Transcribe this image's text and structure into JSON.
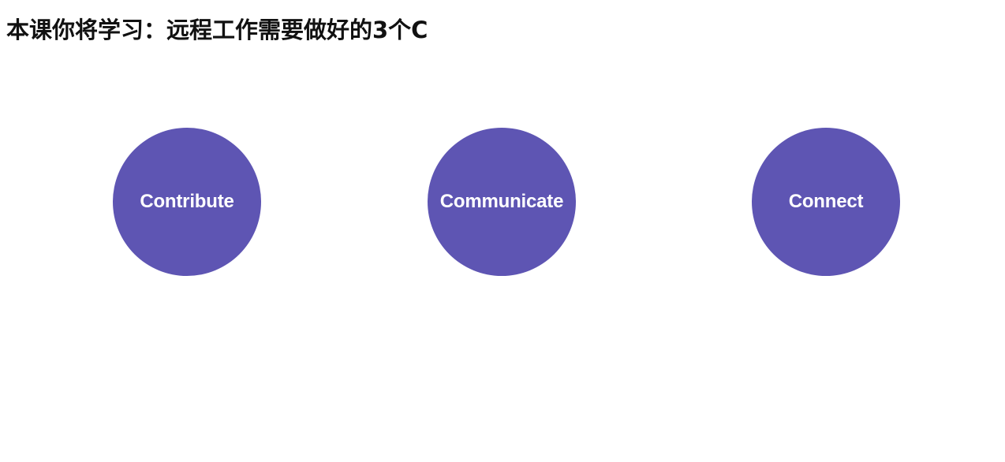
{
  "slide": {
    "title": "本课你将学习：远程工作需要做好的3个C",
    "items": [
      {
        "label": "Contribute"
      },
      {
        "label": "Communicate"
      },
      {
        "label": "Connect"
      }
    ]
  },
  "colors": {
    "background": "#ffffff",
    "title_text": "#111111",
    "circle_fill": "#5e55b3",
    "circle_text": "#ffffff"
  }
}
